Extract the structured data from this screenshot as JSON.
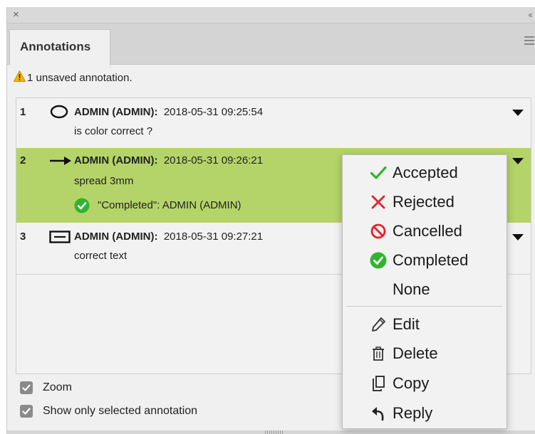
{
  "panel": {
    "tab_label": "Annotations",
    "close_glyph": "×",
    "collapse_glyph": "‹‹",
    "icons": [
      "close-icon",
      "collapse-icon",
      "panel-menu-icon"
    ]
  },
  "warning": {
    "icon": "warning-icon",
    "color": "#f2b705",
    "text": "1 unsaved annotation."
  },
  "annotations": [
    {
      "num": "1",
      "icon": "ellipse-icon",
      "author": "ADMIN (ADMIN):",
      "timestamp": "2018-05-31 09:25:54",
      "text": "is color correct ?",
      "selected": false
    },
    {
      "num": "2",
      "icon": "arrow-icon",
      "author": "ADMIN (ADMIN):",
      "timestamp": "2018-05-31 09:26:21",
      "text": "spread 3mm",
      "status_text": "\"Completed\": ADMIN (ADMIN)",
      "status_icon": "completed-check-icon",
      "selected": true,
      "highlight_color": "#b4d469"
    },
    {
      "num": "3",
      "icon": "text-box-icon",
      "author": "ADMIN (ADMIN):",
      "timestamp": "2018-05-31 09:27:21",
      "text": "correct text",
      "selected": false
    }
  ],
  "options": {
    "zoom_label": "Zoom",
    "zoom_checked": true,
    "show_selected_label": "Show only selected annotation",
    "show_selected_checked": true
  },
  "context_menu": {
    "status_items": [
      {
        "label": "Accepted",
        "icon": "check-icon",
        "color": "#2fb52f"
      },
      {
        "label": "Rejected",
        "icon": "x-icon",
        "color": "#e8202a"
      },
      {
        "label": "Cancelled",
        "icon": "cancel-icon",
        "color": "#e8202a"
      },
      {
        "label": "Completed",
        "icon": "completed-check-icon",
        "color": "#2fb52f"
      },
      {
        "label": "None",
        "icon": "",
        "color": ""
      }
    ],
    "action_items": [
      {
        "label": "Edit",
        "icon": "pencil-icon"
      },
      {
        "label": "Delete",
        "icon": "trash-icon"
      },
      {
        "label": "Copy",
        "icon": "copy-icon"
      },
      {
        "label": "Reply",
        "icon": "reply-icon"
      }
    ]
  }
}
